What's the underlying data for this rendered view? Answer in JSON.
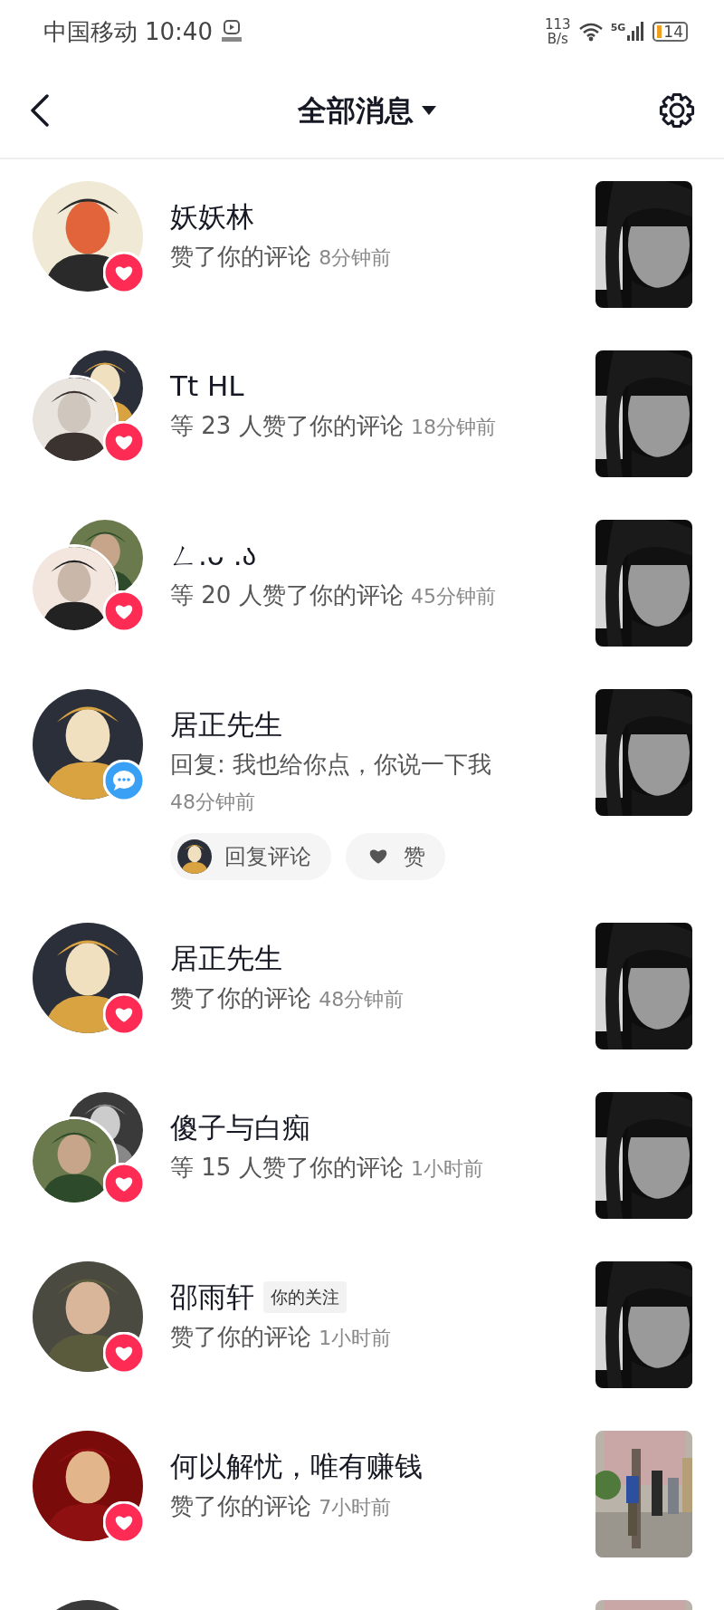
{
  "status_bar": {
    "carrier": "中国移动",
    "time": "10:40",
    "net_speed": "113",
    "net_unit": "B/s",
    "network": "5G",
    "battery": "14"
  },
  "header": {
    "title": "全部消息"
  },
  "notifications": [
    {
      "name": "妖妖林",
      "action": "赞了你的评论",
      "time": "8分钟前",
      "badge": {
        "kind": "like"
      },
      "avatars": [
        {
          "kind": "picture"
        }
      ],
      "thumbnail": {
        "kind": "picture"
      }
    },
    {
      "name": "Tt HL",
      "action": "等 23 人赞了你的评论",
      "time": "18分钟前",
      "badge": {
        "kind": "like"
      },
      "avatars": [
        {
          "kind": "picture"
        },
        {
          "kind": "picture"
        }
      ],
      "thumbnail": {
        "kind": "picture"
      }
    },
    {
      "name": "ㄥ.ᴗ .ა",
      "action": "等 20 人赞了你的评论",
      "time": "45分钟前",
      "badge": {
        "kind": "like"
      },
      "avatars": [
        {
          "kind": "picture"
        },
        {
          "kind": "picture"
        }
      ],
      "thumbnail": {
        "kind": "picture"
      }
    },
    {
      "name": "居正先生",
      "action": "回复: 我也给你点，你说一下我",
      "time": "48分钟前",
      "badge": {
        "kind": "comment"
      },
      "avatars": [
        {
          "kind": "picture"
        }
      ],
      "thumbnail": {
        "kind": "picture"
      },
      "actions": [
        {
          "label": "回复评论",
          "kind": "reply"
        },
        {
          "label": "赞",
          "kind": "like"
        }
      ]
    },
    {
      "name": "居正先生",
      "action": "赞了你的评论",
      "time": "48分钟前",
      "badge": {
        "kind": "like"
      },
      "avatars": [
        {
          "kind": "picture"
        }
      ],
      "thumbnail": {
        "kind": "picture"
      }
    },
    {
      "name": "傻子与白痴",
      "action": "等 15 人赞了你的评论",
      "time": "1小时前",
      "badge": {
        "kind": "like"
      },
      "avatars": [
        {
          "kind": "picture"
        },
        {
          "kind": "picture"
        }
      ],
      "thumbnail": {
        "kind": "picture"
      }
    },
    {
      "name": "邵雨轩",
      "tag": "你的关注",
      "action": "赞了你的评论",
      "time": "1小时前",
      "badge": {
        "kind": "like"
      },
      "avatars": [
        {
          "kind": "picture"
        }
      ],
      "thumbnail": {
        "kind": "picture"
      }
    },
    {
      "name": "何以解忧，唯有赚钱",
      "action": "赞了你的评论",
      "time": "7小时前",
      "badge": {
        "kind": "like"
      },
      "avatars": [
        {
          "kind": "picture"
        }
      ],
      "thumbnail": {
        "kind": "picture"
      }
    },
    {
      "avatars": [
        {
          "kind": "picture"
        }
      ],
      "thumbnail": {
        "kind": "picture"
      }
    }
  ]
}
